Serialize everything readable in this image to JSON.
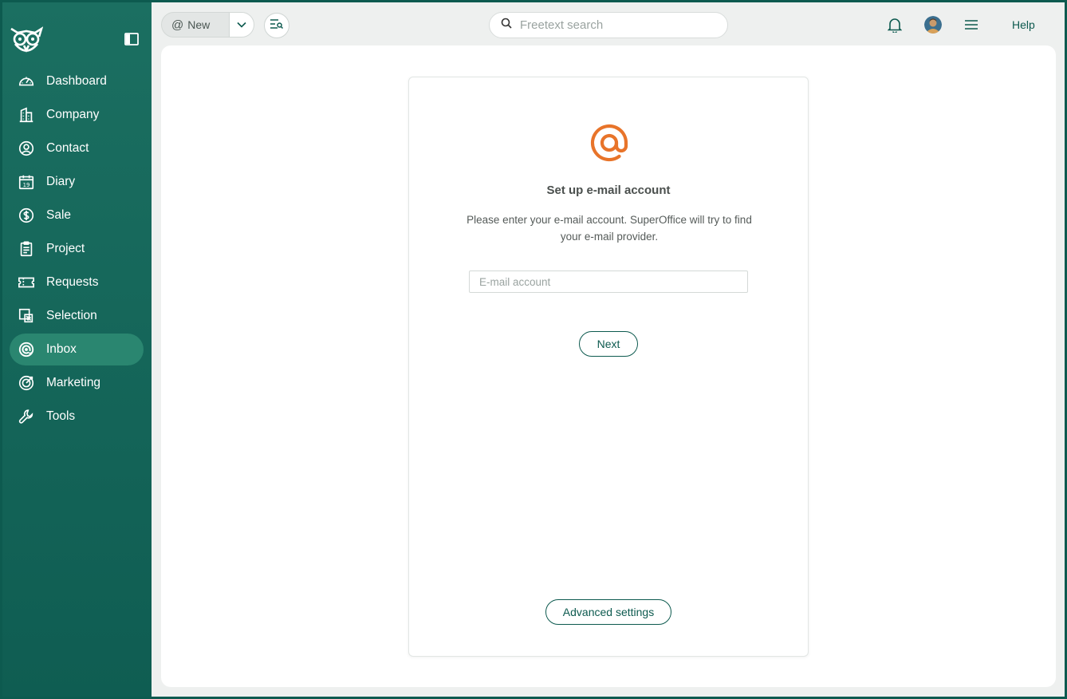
{
  "sidebar": {
    "logo_icon": "owl-logo-icon",
    "collapse_icon": "sidebar-collapse-icon",
    "items": [
      {
        "label": "Dashboard",
        "icon": "gauge-icon",
        "active": false
      },
      {
        "label": "Company",
        "icon": "building-icon",
        "active": false
      },
      {
        "label": "Contact",
        "icon": "person-circle-icon",
        "active": false
      },
      {
        "label": "Diary",
        "icon": "calendar-icon",
        "active": false
      },
      {
        "label": "Sale",
        "icon": "dollar-circle-icon",
        "active": false
      },
      {
        "label": "Project",
        "icon": "clipboard-icon",
        "active": false
      },
      {
        "label": "Requests",
        "icon": "ticket-icon",
        "active": false
      },
      {
        "label": "Selection",
        "icon": "selection-icon",
        "active": false
      },
      {
        "label": "Inbox",
        "icon": "at-circle-icon",
        "active": true
      },
      {
        "label": "Marketing",
        "icon": "target-icon",
        "active": false
      },
      {
        "label": "Tools",
        "icon": "wrench-icon",
        "active": false
      }
    ]
  },
  "topbar": {
    "new_label": "New",
    "search_placeholder": "Freetext search",
    "help_label": "Help"
  },
  "card": {
    "title": "Set up e-mail account",
    "description": "Please enter your e-mail account. SuperOffice will try to find your e-mail provider.",
    "email_placeholder": "E-mail account",
    "email_value": "",
    "next_label": "Next",
    "advanced_label": "Advanced settings"
  },
  "colors": {
    "sidebar_bg": "#1b6f61",
    "accent": "#0d5a4f",
    "active_item": "#2a8670",
    "at_logo": "#e8742a"
  }
}
